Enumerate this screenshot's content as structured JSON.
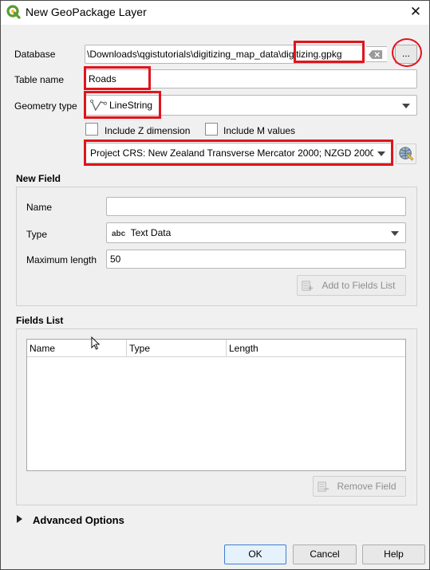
{
  "window": {
    "title": "New GeoPackage Layer"
  },
  "database": {
    "label": "Database",
    "path": "\\Downloads\\qgistutorials\\digitizing_map_data\\digitizing.gpkg",
    "browse_label": "..."
  },
  "table_name": {
    "label": "Table name",
    "value": "Roads"
  },
  "geometry_type": {
    "label": "Geometry type",
    "value": "LineString"
  },
  "options": {
    "include_z": "Include Z dimension",
    "include_m": "Include M values"
  },
  "crs": {
    "value": "Project CRS: New Zealand Transverse Mercator 2000; NZGD 2000"
  },
  "new_field": {
    "title": "New Field",
    "name_label": "Name",
    "name_value": "",
    "type_label": "Type",
    "type_badge": "abc",
    "type_value": "Text Data",
    "maxlen_label": "Maximum length",
    "maxlen_value": "50",
    "add_button": "Add to Fields List"
  },
  "fields_list": {
    "title": "Fields List",
    "columns": [
      "Name",
      "Type",
      "Length"
    ],
    "remove_button": "Remove Field"
  },
  "advanced": {
    "label": "Advanced Options"
  },
  "buttons": {
    "ok": "OK",
    "cancel": "Cancel",
    "help": "Help"
  },
  "colors": {
    "highlight": "#e0141c",
    "accent": "#5b9a32"
  }
}
